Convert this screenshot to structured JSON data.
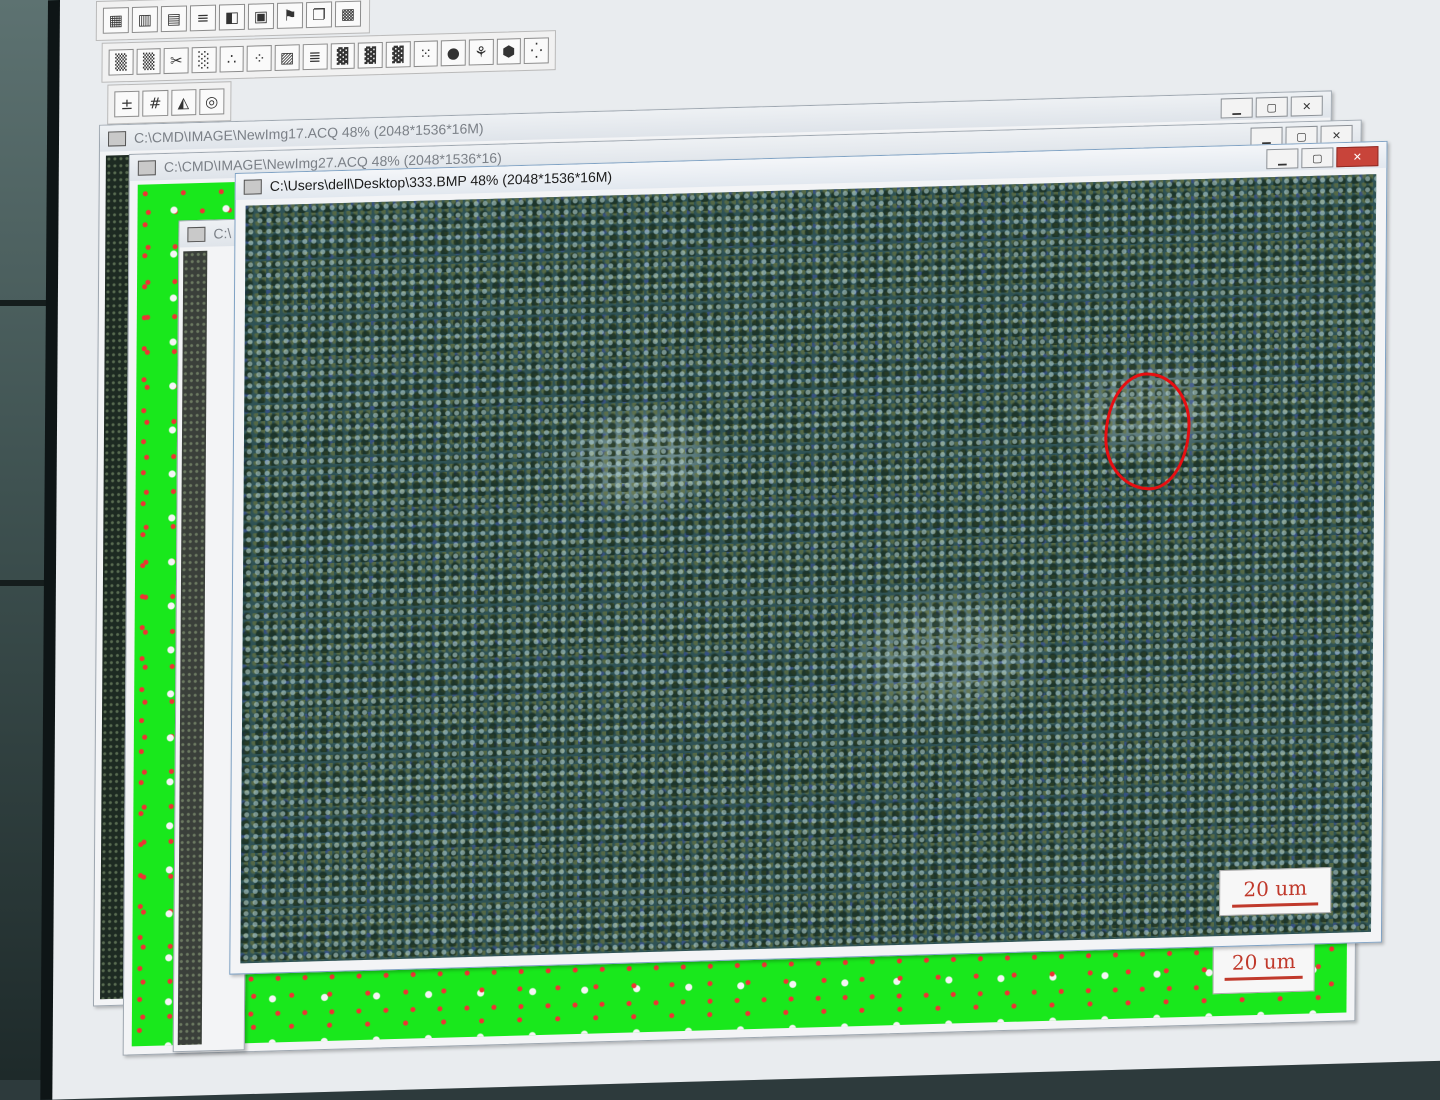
{
  "toolbars": {
    "row1": [
      "chart-icon",
      "bars-icon",
      "histogram-icon",
      "levels-icon",
      "contrast-icon",
      "table-icon",
      "flag-icon",
      "stack-icon",
      "palette-icon"
    ],
    "row2": [
      "grain-icon",
      "grain-icon",
      "mask-icon",
      "texture-icon",
      "dots-icon",
      "particles-icon",
      "color-map-icon",
      "lines-icon",
      "noise-icon",
      "noise-icon",
      "noise-icon",
      "scatter-icon",
      "blob-icon",
      "branch-icon",
      "cell-icon",
      "points-icon"
    ],
    "row3": [
      "measure-icon",
      "grid-icon",
      "plot-icon",
      "report-icon"
    ]
  },
  "glyphs": {
    "chart-icon": "▦",
    "bars-icon": "▥",
    "histogram-icon": "▤",
    "levels-icon": "≡",
    "contrast-icon": "◧",
    "table-icon": "▣",
    "flag-icon": "⚑",
    "stack-icon": "❐",
    "palette-icon": "▩",
    "grain-icon": "▒",
    "mask-icon": "✂",
    "texture-icon": "░",
    "dots-icon": "∴",
    "particles-icon": "⁘",
    "color-map-icon": "▨",
    "lines-icon": "≣",
    "noise-icon": "▓",
    "scatter-icon": "⁙",
    "blob-icon": "●",
    "branch-icon": "⚘",
    "cell-icon": "⬢",
    "points-icon": "⁛",
    "measure-icon": "±",
    "grid-icon": "#",
    "plot-icon": "◭",
    "report-icon": "◎"
  },
  "windows": {
    "back1": {
      "title": "C:\\CMD\\IMAGE\\NewImg17.ACQ  48% (2048*1536*16M)"
    },
    "back2": {
      "title": "C:\\CMD\\IMAGE\\NewImg27.ACQ  48% (2048*1536*16)"
    },
    "back3": {
      "title": "C:\\"
    },
    "front": {
      "title": "C:\\Users\\dell\\Desktop\\333.BMP  48% (2048*1536*16M)"
    }
  },
  "window_controls": {
    "minimize": "▁",
    "maximize": "▢",
    "close": "✕"
  },
  "scale_bars": {
    "front": "20 um",
    "back": "20 um",
    "partial": "20 um"
  },
  "colors": {
    "segmentation_green": "#19e81c",
    "marker_red": "#e60f12",
    "scale_text": "#c0392b"
  }
}
